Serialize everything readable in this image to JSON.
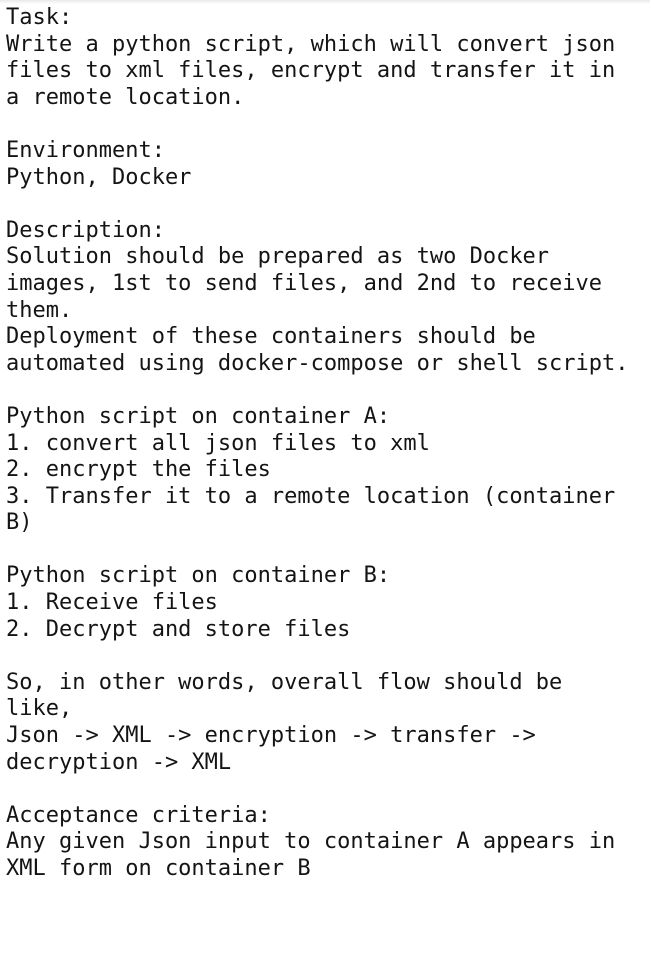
{
  "document": {
    "lines": [
      "Task:",
      "Write a python script, which will convert json",
      "files to xml files, encrypt and transfer it in",
      "a remote location.",
      "",
      "Environment:",
      "Python, Docker",
      "",
      "Description:",
      "Solution should be prepared as two Docker",
      "images, 1st to send files, and 2nd to receive",
      "them.",
      "Deployment of these containers should be",
      "automated using docker-compose or shell script.",
      "",
      "Python script on container A:",
      "1. convert all json files to xml",
      "2. encrypt the files",
      "3. Transfer it to a remote location (container",
      "B)",
      "",
      "Python script on container B:",
      "1. Receive files",
      "2. Decrypt and store files",
      "",
      "So, in other words, overall flow should be",
      "like,",
      "Json -> XML -> encryption -> transfer ->",
      "decryption -> XML",
      "",
      "Acceptance criteria:",
      "Any given Json input to container A appears in",
      "XML form on container B"
    ]
  }
}
